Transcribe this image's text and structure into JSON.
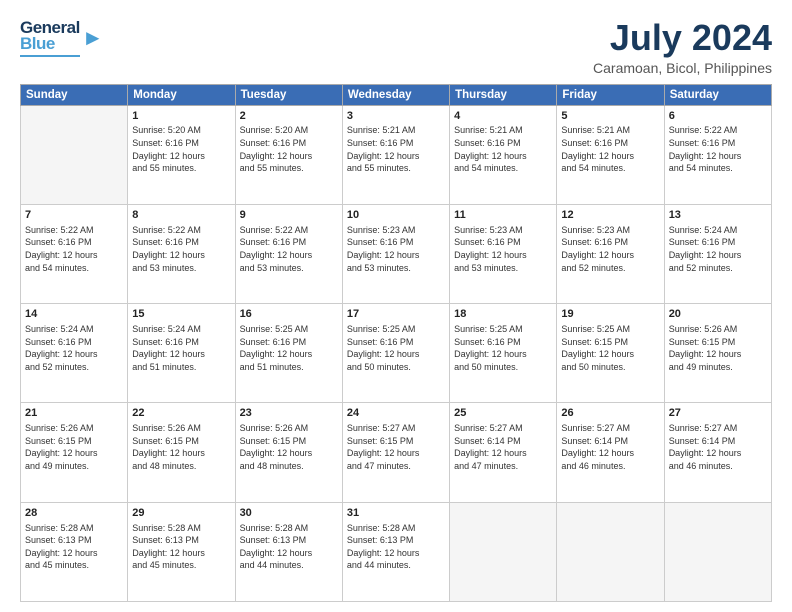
{
  "header": {
    "logo_top": "General",
    "logo_bottom": "Blue",
    "month_year": "July 2024",
    "location": "Caramoan, Bicol, Philippines"
  },
  "days_of_week": [
    "Sunday",
    "Monday",
    "Tuesday",
    "Wednesday",
    "Thursday",
    "Friday",
    "Saturday"
  ],
  "weeks": [
    [
      {
        "day": "",
        "empty": true
      },
      {
        "day": "1",
        "sunrise": "5:20 AM",
        "sunset": "6:16 PM",
        "daylight": "12 hours and 55 minutes."
      },
      {
        "day": "2",
        "sunrise": "5:20 AM",
        "sunset": "6:16 PM",
        "daylight": "12 hours and 55 minutes."
      },
      {
        "day": "3",
        "sunrise": "5:21 AM",
        "sunset": "6:16 PM",
        "daylight": "12 hours and 55 minutes."
      },
      {
        "day": "4",
        "sunrise": "5:21 AM",
        "sunset": "6:16 PM",
        "daylight": "12 hours and 54 minutes."
      },
      {
        "day": "5",
        "sunrise": "5:21 AM",
        "sunset": "6:16 PM",
        "daylight": "12 hours and 54 minutes."
      },
      {
        "day": "6",
        "sunrise": "5:22 AM",
        "sunset": "6:16 PM",
        "daylight": "12 hours and 54 minutes."
      }
    ],
    [
      {
        "day": "7",
        "sunrise": "5:22 AM",
        "sunset": "6:16 PM",
        "daylight": "12 hours and 54 minutes."
      },
      {
        "day": "8",
        "sunrise": "5:22 AM",
        "sunset": "6:16 PM",
        "daylight": "12 hours and 53 minutes."
      },
      {
        "day": "9",
        "sunrise": "5:22 AM",
        "sunset": "6:16 PM",
        "daylight": "12 hours and 53 minutes."
      },
      {
        "day": "10",
        "sunrise": "5:23 AM",
        "sunset": "6:16 PM",
        "daylight": "12 hours and 53 minutes."
      },
      {
        "day": "11",
        "sunrise": "5:23 AM",
        "sunset": "6:16 PM",
        "daylight": "12 hours and 53 minutes."
      },
      {
        "day": "12",
        "sunrise": "5:23 AM",
        "sunset": "6:16 PM",
        "daylight": "12 hours and 52 minutes."
      },
      {
        "day": "13",
        "sunrise": "5:24 AM",
        "sunset": "6:16 PM",
        "daylight": "12 hours and 52 minutes."
      }
    ],
    [
      {
        "day": "14",
        "sunrise": "5:24 AM",
        "sunset": "6:16 PM",
        "daylight": "12 hours and 52 minutes."
      },
      {
        "day": "15",
        "sunrise": "5:24 AM",
        "sunset": "6:16 PM",
        "daylight": "12 hours and 51 minutes."
      },
      {
        "day": "16",
        "sunrise": "5:25 AM",
        "sunset": "6:16 PM",
        "daylight": "12 hours and 51 minutes."
      },
      {
        "day": "17",
        "sunrise": "5:25 AM",
        "sunset": "6:16 PM",
        "daylight": "12 hours and 50 minutes."
      },
      {
        "day": "18",
        "sunrise": "5:25 AM",
        "sunset": "6:16 PM",
        "daylight": "12 hours and 50 minutes."
      },
      {
        "day": "19",
        "sunrise": "5:25 AM",
        "sunset": "6:15 PM",
        "daylight": "12 hours and 50 minutes."
      },
      {
        "day": "20",
        "sunrise": "5:26 AM",
        "sunset": "6:15 PM",
        "daylight": "12 hours and 49 minutes."
      }
    ],
    [
      {
        "day": "21",
        "sunrise": "5:26 AM",
        "sunset": "6:15 PM",
        "daylight": "12 hours and 49 minutes."
      },
      {
        "day": "22",
        "sunrise": "5:26 AM",
        "sunset": "6:15 PM",
        "daylight": "12 hours and 48 minutes."
      },
      {
        "day": "23",
        "sunrise": "5:26 AM",
        "sunset": "6:15 PM",
        "daylight": "12 hours and 48 minutes."
      },
      {
        "day": "24",
        "sunrise": "5:27 AM",
        "sunset": "6:15 PM",
        "daylight": "12 hours and 47 minutes."
      },
      {
        "day": "25",
        "sunrise": "5:27 AM",
        "sunset": "6:14 PM",
        "daylight": "12 hours and 47 minutes."
      },
      {
        "day": "26",
        "sunrise": "5:27 AM",
        "sunset": "6:14 PM",
        "daylight": "12 hours and 46 minutes."
      },
      {
        "day": "27",
        "sunrise": "5:27 AM",
        "sunset": "6:14 PM",
        "daylight": "12 hours and 46 minutes."
      }
    ],
    [
      {
        "day": "28",
        "sunrise": "5:28 AM",
        "sunset": "6:13 PM",
        "daylight": "12 hours and 45 minutes."
      },
      {
        "day": "29",
        "sunrise": "5:28 AM",
        "sunset": "6:13 PM",
        "daylight": "12 hours and 45 minutes."
      },
      {
        "day": "30",
        "sunrise": "5:28 AM",
        "sunset": "6:13 PM",
        "daylight": "12 hours and 44 minutes."
      },
      {
        "day": "31",
        "sunrise": "5:28 AM",
        "sunset": "6:13 PM",
        "daylight": "12 hours and 44 minutes."
      },
      {
        "day": "",
        "empty": true
      },
      {
        "day": "",
        "empty": true
      },
      {
        "day": "",
        "empty": true
      }
    ]
  ]
}
